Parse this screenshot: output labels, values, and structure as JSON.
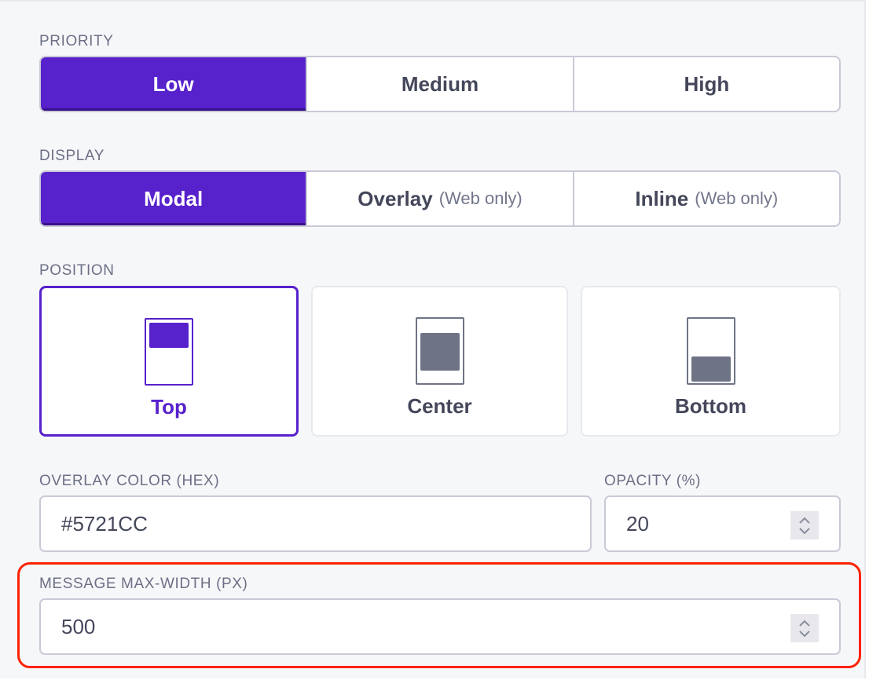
{
  "priority": {
    "label": "Priority",
    "options": [
      {
        "label": "Low",
        "active": true
      },
      {
        "label": "Medium",
        "active": false
      },
      {
        "label": "High",
        "active": false
      }
    ]
  },
  "display": {
    "label": "Display",
    "options": [
      {
        "label": "Modal",
        "sub": "",
        "active": true
      },
      {
        "label": "Overlay",
        "sub": "(Web only)",
        "active": false
      },
      {
        "label": "Inline",
        "sub": "(Web only)",
        "active": false
      }
    ]
  },
  "position": {
    "label": "Position",
    "options": [
      {
        "label": "Top",
        "active": true
      },
      {
        "label": "Center",
        "active": false
      },
      {
        "label": "Bottom",
        "active": false
      }
    ]
  },
  "overlay_color": {
    "label": "Overlay Color (HEX)",
    "value": "#5721CC"
  },
  "opacity": {
    "label": "Opacity (%)",
    "value": "20"
  },
  "max_width": {
    "label": "Message Max-Width (PX)",
    "value": "500"
  },
  "colors": {
    "accent": "#5721CC",
    "highlight": "#FF2200"
  }
}
